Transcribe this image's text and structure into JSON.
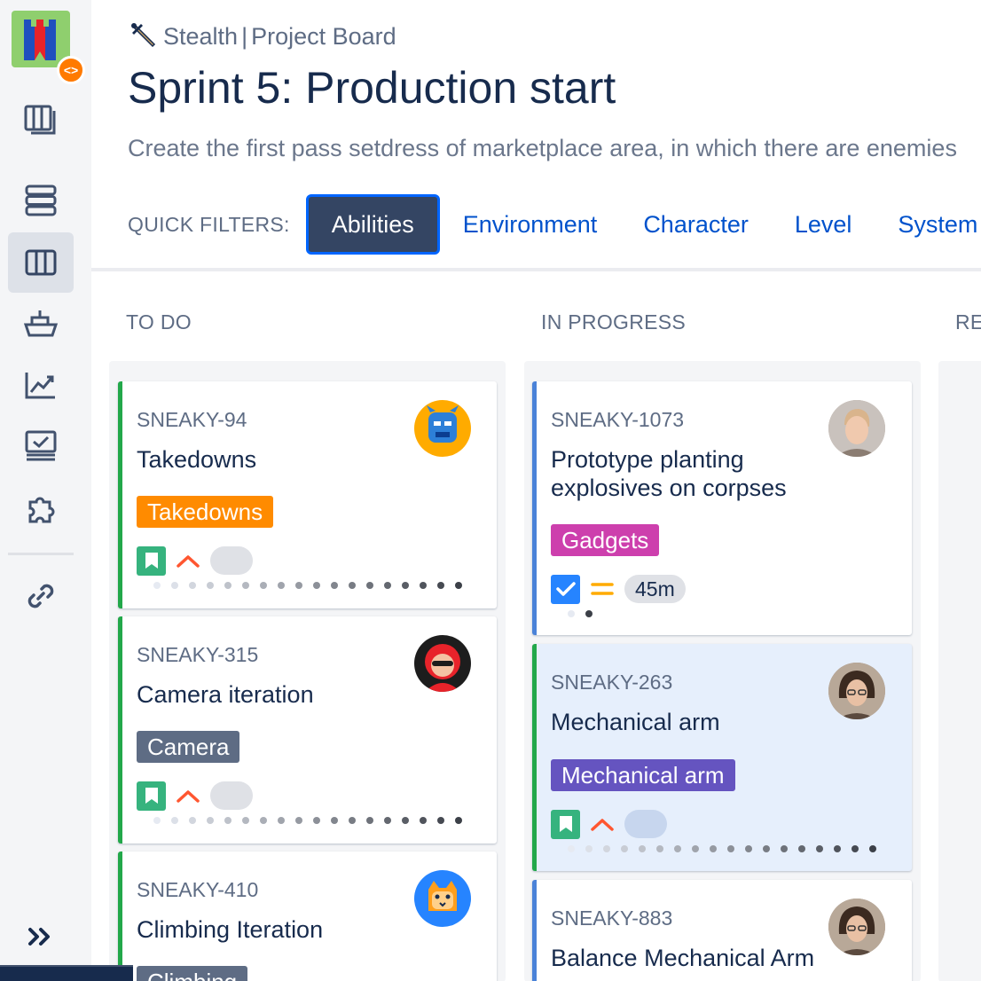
{
  "breadcrumb": {
    "project": "Stealth",
    "separator": "|",
    "board": "Project Board"
  },
  "sprint": {
    "title": "Sprint 5: Production start",
    "description": "Create the first pass setdress of marketplace area, in which there are enemies"
  },
  "quick_filters": {
    "label": "QUICK FILTERS:",
    "items": [
      {
        "label": "Abilities",
        "active": true
      },
      {
        "label": "Environment",
        "active": false
      },
      {
        "label": "Character",
        "active": false
      },
      {
        "label": "Level",
        "active": false
      },
      {
        "label": "System",
        "active": false
      }
    ]
  },
  "columns": [
    {
      "title": "TO DO"
    },
    {
      "title": "IN PROGRESS"
    },
    {
      "title": "RE"
    }
  ],
  "cards": {
    "c94": {
      "key": "SNEAKY-94",
      "summary": "Takedowns",
      "epic": "Takedowns",
      "epic_color": "#ff8b00",
      "type": "story",
      "priority": "high",
      "estimate": ""
    },
    "c315": {
      "key": "SNEAKY-315",
      "summary": "Camera iteration",
      "epic": "Camera",
      "epic_color": "#5e6c84",
      "type": "story",
      "priority": "high",
      "estimate": ""
    },
    "c410": {
      "key": "SNEAKY-410",
      "summary": "Climbing Iteration",
      "epic": "Climbing",
      "epic_color": "#5e6c84",
      "type": "story",
      "priority": "high",
      "estimate": ""
    },
    "c1073": {
      "key": "SNEAKY-1073",
      "summary": "Prototype planting explosives on corpses",
      "epic": "Gadgets",
      "epic_color": "#cd3fad",
      "type": "task",
      "priority": "medium",
      "estimate": "45m"
    },
    "c263": {
      "key": "SNEAKY-263",
      "summary": "Mechanical arm",
      "epic": "Mechanical arm",
      "epic_color": "#6554c0",
      "type": "story",
      "priority": "high",
      "estimate": ""
    },
    "c883": {
      "key": "SNEAKY-883",
      "summary": "Balance Mechanical Arm",
      "epic": "",
      "epic_color": "",
      "type": "story",
      "priority": "high",
      "estimate": ""
    }
  },
  "colors": {
    "accent": "#0052cc",
    "active_filter_bg": "#344563",
    "story": "#36b37e",
    "task": "#2684ff",
    "priority_high": "#ff5630",
    "priority_medium": "#ffab00",
    "card_edge_green": "#22a84a",
    "card_edge_blue": "#4a82d8"
  },
  "icons": {
    "sidebar": [
      "backlog-icon",
      "roadmap-icon",
      "board-icon",
      "releases-icon",
      "reports-icon",
      "issues-icon",
      "addons-icon",
      "project-link-icon",
      "expand-sidebar-icon"
    ],
    "breadcrumb": "dagger-icon"
  }
}
